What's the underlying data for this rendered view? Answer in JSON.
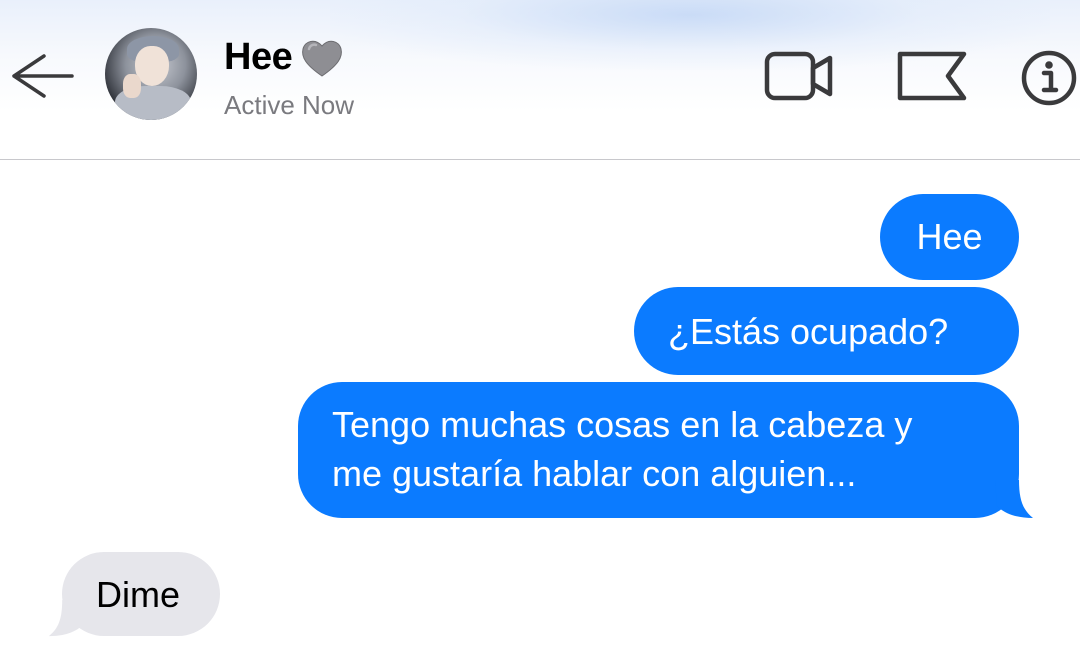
{
  "header": {
    "back_icon": "arrow-left-icon",
    "contact_name": "Hee",
    "name_emoji": "grey-heart-icon",
    "status": "Active Now",
    "actions": [
      "video-camera-icon",
      "flag-icon",
      "info-icon"
    ]
  },
  "messages": [
    {
      "direction": "sent",
      "text": "Hee"
    },
    {
      "direction": "sent",
      "text": "¿Estás ocupado?"
    },
    {
      "direction": "sent",
      "lines": [
        "Tengo muchas cosas en la cabeza y",
        "me gustaría hablar con alguien..."
      ]
    },
    {
      "direction": "received",
      "text": "Dime"
    }
  ],
  "colors": {
    "sent_bubble": "#0b7bff",
    "received_bubble": "#e6e6eb",
    "status_text": "#7a7a7f",
    "icon_stroke": "#3a3a3c"
  }
}
